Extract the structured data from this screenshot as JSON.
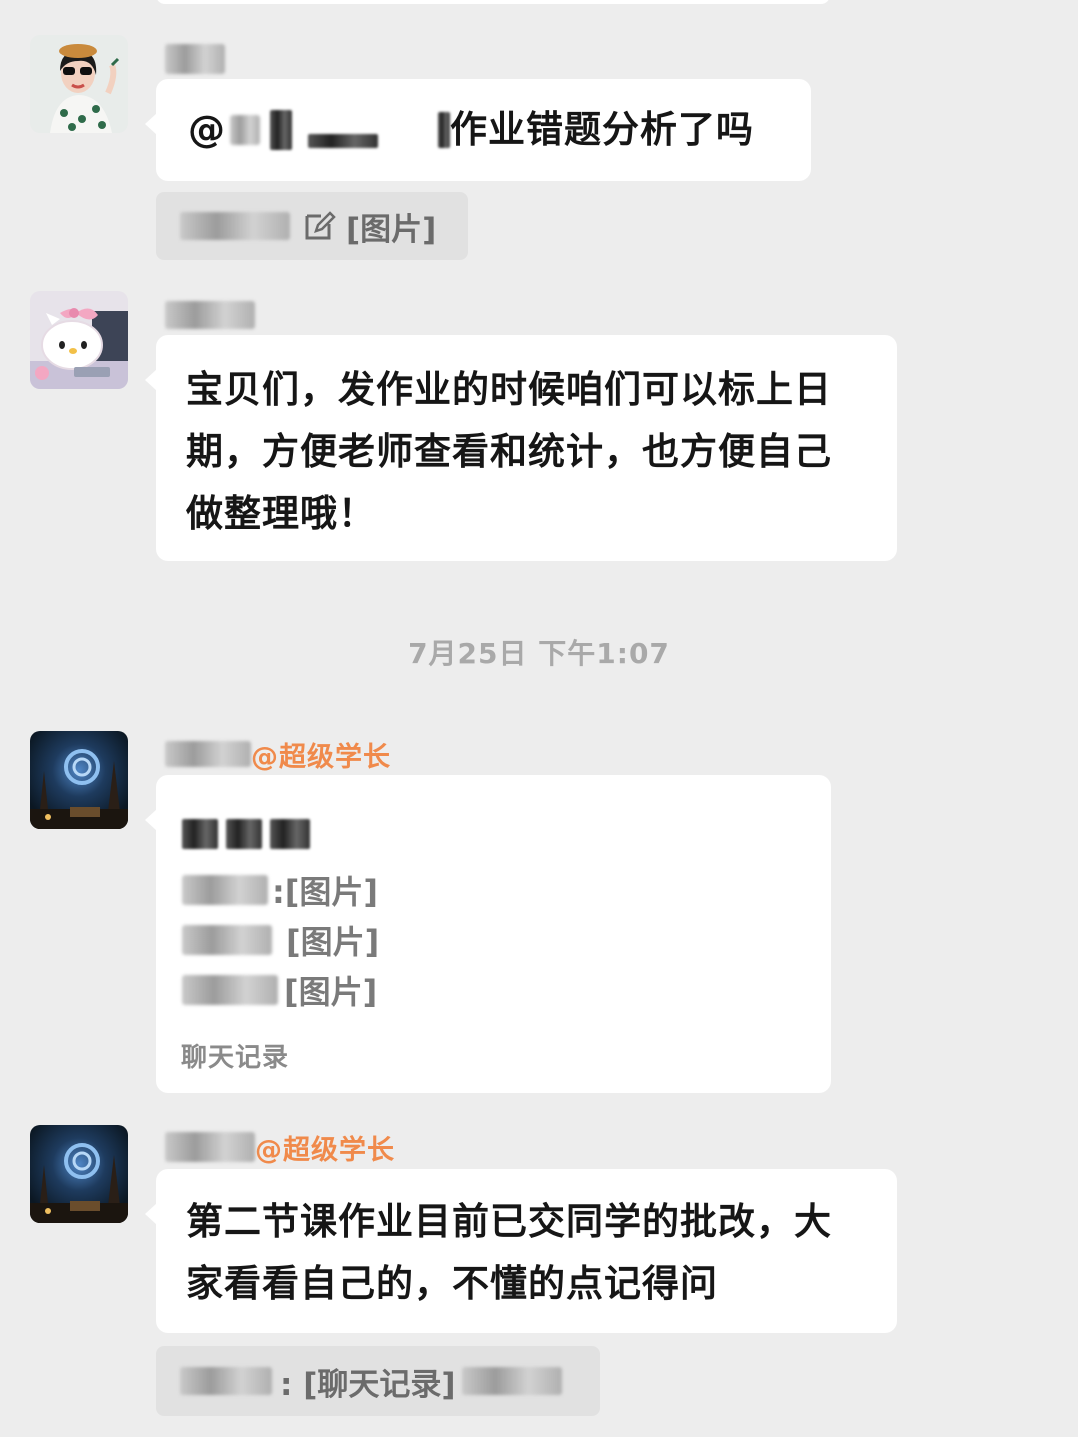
{
  "messages": [
    {
      "text_prefix": "@",
      "text": "作业错题分析了吗",
      "quote": {
        "text": "[图片]",
        "icon": "edit-icon"
      }
    },
    {
      "text_lines": [
        "宝贝们，发作业的时候咱们可以标上日",
        "期，方便老师查看和统计，也方便自己",
        "做整理哦！"
      ]
    },
    {
      "sender_tag": "@超级学长",
      "record_items": [
        ":[图片]",
        "[图片]",
        "[图片]"
      ],
      "record_footer": "聊天记录"
    },
    {
      "sender_tag": "@超级学长",
      "text_lines": [
        "第二节课作业目前已交同学的批改，大",
        "家看看自己的，不懂的点记得问"
      ],
      "quote": {
        "text": ": [聊天记录]"
      }
    }
  ],
  "timestamp": "7月25日 下午1:07",
  "colors": {
    "background": "#ededed",
    "bubble": "#ffffff",
    "quote": "#e1e1e1",
    "sender_tag": "#f08a4b",
    "timestamp": "#a9a9a9"
  }
}
